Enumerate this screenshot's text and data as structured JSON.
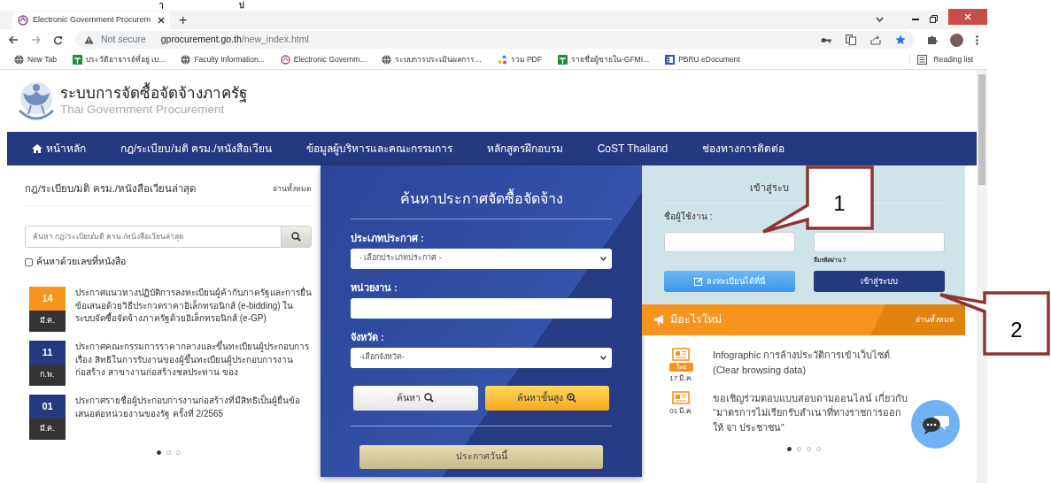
{
  "top_fragments": [
    "ๅ",
    "ป"
  ],
  "browser": {
    "tab": {
      "title": "Electronic Government Procurem"
    },
    "new_tab": "+",
    "address": {
      "security": "Not secure",
      "domain": "gprocurement.go.th",
      "path": "/new_index.html"
    },
    "bookmarks": [
      {
        "label": "New Tab",
        "kind": "globe"
      },
      {
        "label": "ประวัติอาจารย์ที่อยู่ เบ...",
        "kind": "sheet"
      },
      {
        "label": "Faculty Information...",
        "kind": "globe"
      },
      {
        "label": "Electronic Governm...",
        "kind": "emblem"
      },
      {
        "label": "ระบบการประเมินผลการ...",
        "kind": "globe"
      },
      {
        "label": "รวม PDF",
        "kind": "dots"
      },
      {
        "label": "รายชื่อผู้ขายใน-GFMI...",
        "kind": "sheet"
      },
      {
        "label": "PBRU eDocument",
        "kind": "doc"
      }
    ],
    "reading_list": "Reading list"
  },
  "site": {
    "title": "ระบบการจัดซื้อจัดจ้างภาครัฐ",
    "subtitle": "Thai Government Procurement"
  },
  "nav": [
    {
      "label": "หน้าหลัก",
      "kind": "home"
    },
    {
      "label": "กฎ/ระเบียบ/มติ ครม./หนังสือเวียน",
      "kind": "text"
    },
    {
      "label": "ข้อมูลผู้บริหารและคณะกรรมการ",
      "kind": "text"
    },
    {
      "label": "หลักสูตรฝึกอบรม",
      "kind": "text"
    },
    {
      "label": "CoST Thailand",
      "kind": "text"
    },
    {
      "label": "ช่องทางการติดต่อ",
      "kind": "text"
    }
  ],
  "circulars": {
    "title": "กฎ/ระเบียบ/มติ ครม./หนังสือเวียนล่าสุด",
    "read_all": "อ่านทั้งหมด",
    "search": {
      "placeholder": "ค้นหา กฎ/ระเบียบ/มติ ครม./หนังสือเวียนล่าสุด"
    },
    "option": {
      "label": "ค้นหาด้วยเลขที่หนังสือ",
      "checked": false
    },
    "items": [
      {
        "day": "14",
        "month": "มี.ค.",
        "color": "#f7941d",
        "text": "ประกาศแนวทางปฏิบัติการลงทะเบียนผู้ค้ากับภาครัฐและการยื่นข้อเสนอด้วยวิธีประกวดราคาอิเล็กทรอนิกส์ (e-bidding) ในระบบจัดซื้อจัดจ้างภาครัฐด้วยอิเล็กทรอนิกส์ (e-GP)"
      },
      {
        "day": "11",
        "month": "ก.พ.",
        "color": "#243a80",
        "text": "ประกาศคณะกรรมการราคากลางและขึ้นทะเบียนผู้ประกอบการ เรื่อง สิทธิในการรับงานของผู้ขึ้นทะเบียนผู้ประกอบการงานก่อสร้าง สาขางานก่อสร้างชลประทาน ของ"
      },
      {
        "day": "01",
        "month": "มี.ค.",
        "color": "#243a80",
        "text": "ประกาศรายชื่อผู้ประกอบการงานก่อสร้างที่มีสิทธิเป็นผู้ยื่นข้อเสนอต่อหน่วยงานของรัฐ ครั้งที่ 2/2565"
      }
    ],
    "pages": [
      {
        "selected": true
      },
      {
        "selected": false
      },
      {
        "selected": false
      }
    ]
  },
  "search_panel": {
    "title": "ค้นหาประกาศจัดซื้อจัดจ้าง",
    "fields": [
      {
        "label": "ประเภทประกาศ :",
        "kind": "select",
        "value": "- เลือกประเภทประกาศ -"
      },
      {
        "label": "หน่วยงาน :",
        "kind": "text"
      },
      {
        "label": "จังหวัด :",
        "kind": "select",
        "value": "-เลือกจังหวัด-"
      }
    ],
    "buttons": [
      {
        "label": "ค้นหา",
        "kind": "plain"
      },
      {
        "label": "ค้นหาขั้นสูง",
        "kind": "advanced"
      }
    ],
    "today_button": "ประกาศวันนี้"
  },
  "login": {
    "title": "เข้าสู่ระบ",
    "username_label": "ชื่อผู้ใช้งาน :",
    "forgot": "ลืมรหัสผ่าน ?",
    "register_button": "ลงทะเบียนได้ที่นี่",
    "login_button": "เข้าสู่ระบบ"
  },
  "whats_new": {
    "title": "มีอะไรใหม่",
    "read_all": "อ่านทั้งหมด",
    "items": [
      {
        "text": "Infographic การล้างประวัติการเข้าเว็บไซต์ (Clear browsing data)",
        "badge": "ใหม่",
        "date": "17 มี.ค."
      },
      {
        "text": "ขอเชิญร่วมตอบแบบสอบถามออนไลน์ เกี่ยวกับ “มาตรการไม่เรียกรับสำเนาที่ทางราชการออกให้ จา ประชาชน”",
        "date": "01 มี.ค."
      }
    ],
    "pages": [
      {
        "selected": true
      },
      {
        "selected": false
      },
      {
        "selected": false
      },
      {
        "selected": false
      }
    ]
  },
  "callouts": [
    {
      "label": "1"
    },
    {
      "label": "2"
    }
  ]
}
